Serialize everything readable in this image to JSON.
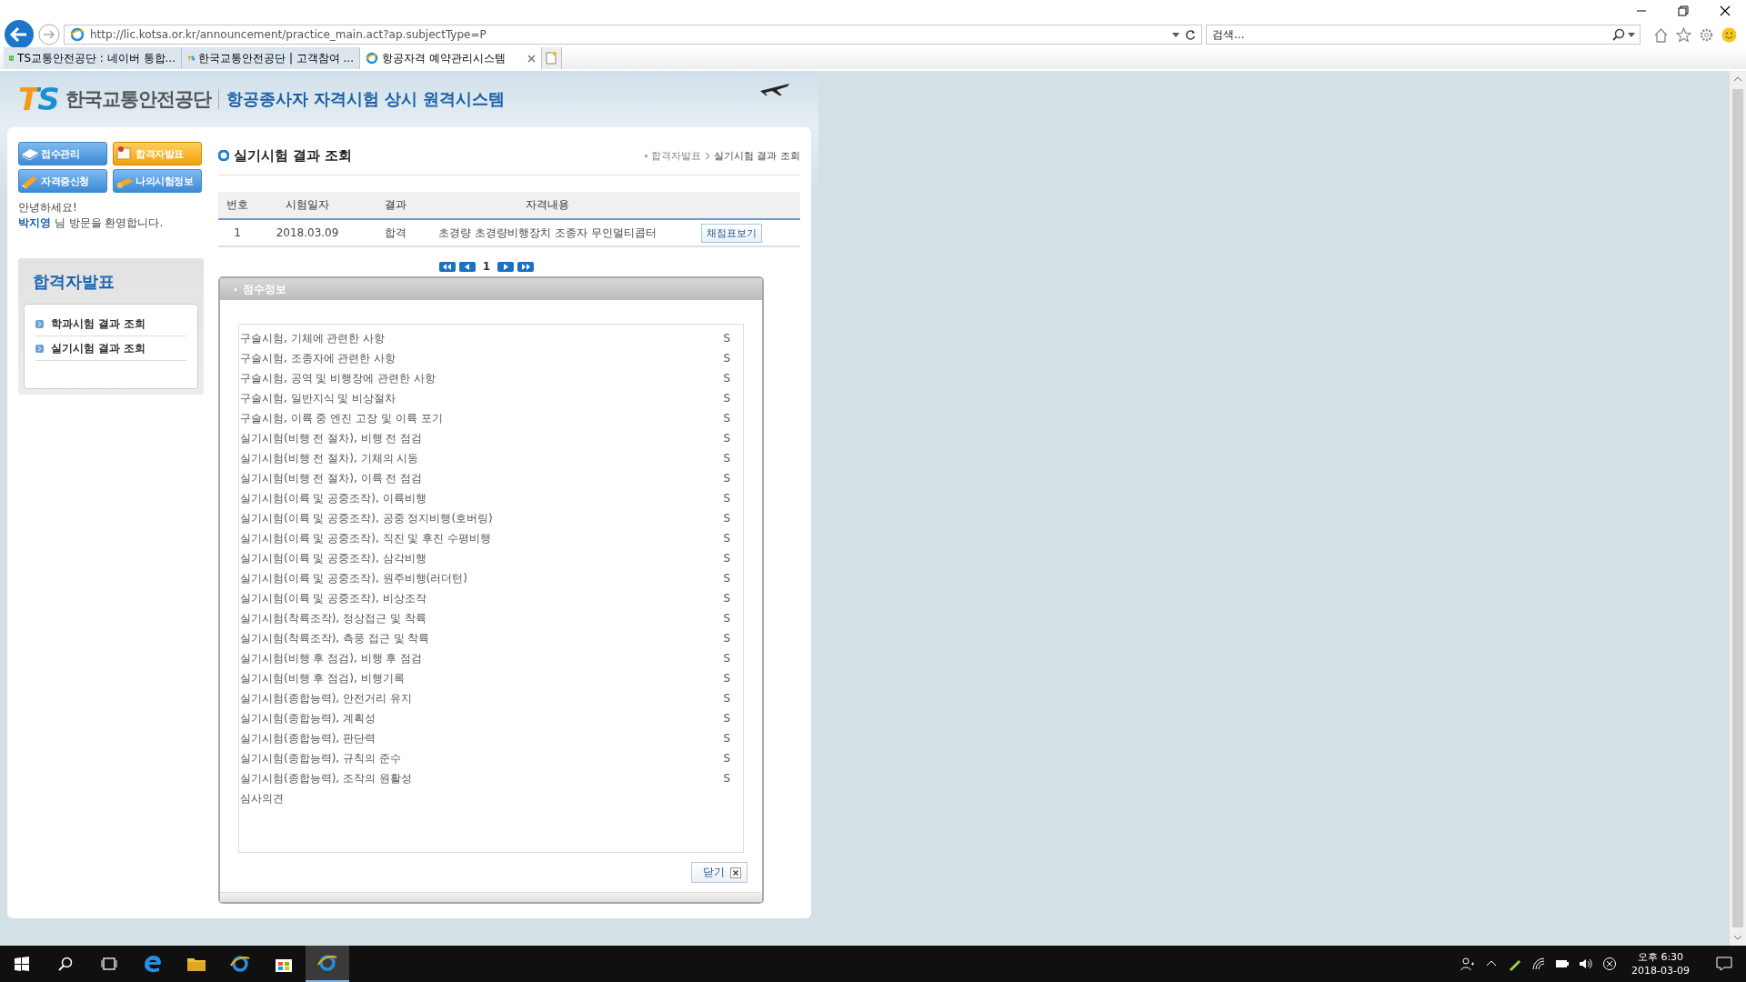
{
  "browser": {
    "address": "http://lic.kotsa.or.kr/announcement/practice_main.act?ap.subjectType=P",
    "search_placeholder": "검색...",
    "tabs": [
      {
        "label": "TS교통안전공단 : 네이버 통합...",
        "selected": false
      },
      {
        "label": "한국교통안전공단 | 고객참여 ...",
        "selected": false
      },
      {
        "label": "항공자격 예약관리시스템",
        "selected": true
      }
    ]
  },
  "header": {
    "logo": "TS",
    "org": "한국교통안전공단",
    "system_title": "항공종사자 자격시험 상시 원격시스템"
  },
  "nav_buttons": [
    {
      "label": "접수관리",
      "selected": false
    },
    {
      "label": "합격자발표",
      "selected": true
    },
    {
      "label": "자격증신청",
      "selected": false
    },
    {
      "label": "나의시험정보",
      "selected": false
    }
  ],
  "greeting": "안녕하세요!",
  "user": {
    "name": "박지영",
    "welcome": "님 방문을 환영합니다."
  },
  "sidebar": {
    "title": "합격자발표",
    "items": [
      "학과시험 결과 조회",
      "실기시험 결과 조회"
    ]
  },
  "page_title": "실기시험 결과 조회",
  "breadcrumb": [
    "합격자발표",
    "실기시험 결과 조회"
  ],
  "table": {
    "columns": [
      "번호",
      "시험일자",
      "결과",
      "자격내용"
    ],
    "rows": [
      {
        "no": "1",
        "date": "2018.03.09",
        "result": "합격",
        "qualification": "초경량 초경량비행장치 조종자 무인멀티콥터",
        "action": "채점표보기"
      }
    ]
  },
  "pagination": {
    "page": "1"
  },
  "score_panel": {
    "title": "점수정보",
    "items": [
      {
        "label": "구술시험, 기체에 관련한 사항",
        "grade": "S"
      },
      {
        "label": "구술시험, 조종자에 관련한 사항",
        "grade": "S"
      },
      {
        "label": "구술시험, 공역 및 비행장에 관련한 사항",
        "grade": "S"
      },
      {
        "label": "구술시험, 일반지식 및 비상절차",
        "grade": "S"
      },
      {
        "label": "구술시험, 이륙 중 엔진 고장 및 이륙 포기",
        "grade": "S"
      },
      {
        "label": "실기시험(비행 전 절차), 비행 전 점검",
        "grade": "S"
      },
      {
        "label": "실기시험(비행 전 절차), 기체의 시동",
        "grade": "S"
      },
      {
        "label": "실기시험(비행 전 절차), 이륙 전 점검",
        "grade": "S"
      },
      {
        "label": "실기시험(이륙 및 공중조작), 이륙비행",
        "grade": "S"
      },
      {
        "label": "실기시험(이륙 및 공중조작), 공중 정지비행(호버링)",
        "grade": "S"
      },
      {
        "label": "실기시험(이륙 및 공중조작), 직진 및 후진 수평비행",
        "grade": "S"
      },
      {
        "label": "실기시험(이륙 및 공중조작), 삼각비행",
        "grade": "S"
      },
      {
        "label": "실기시험(이륙 및 공중조작), 원주비행(러더턴)",
        "grade": "S"
      },
      {
        "label": "실기시험(이륙 및 공중조작), 비상조작",
        "grade": "S"
      },
      {
        "label": "실기시험(착륙조작), 정상접근 및 착륙",
        "grade": "S"
      },
      {
        "label": "실기시험(착륙조작), 측풍 접근 및 착륙",
        "grade": "S"
      },
      {
        "label": "실기시험(비행 후 점검), 비행 후 점검",
        "grade": "S"
      },
      {
        "label": "실기시험(비행 후 점검), 비행기록",
        "grade": "S"
      },
      {
        "label": "실기시험(종합능력), 안전거리 유지",
        "grade": "S"
      },
      {
        "label": "실기시험(종합능력), 계획성",
        "grade": "S"
      },
      {
        "label": "실기시험(종합능력), 판단력",
        "grade": "S"
      },
      {
        "label": "실기시험(종합능력), 규칙의 준수",
        "grade": "S"
      },
      {
        "label": "실기시험(종합능력), 조작의 원활성",
        "grade": "S"
      }
    ],
    "remarks_label": "심사의견",
    "close_button": "닫기"
  },
  "taskbar": {
    "time": "오후 6:30",
    "date": "2018-03-09"
  }
}
